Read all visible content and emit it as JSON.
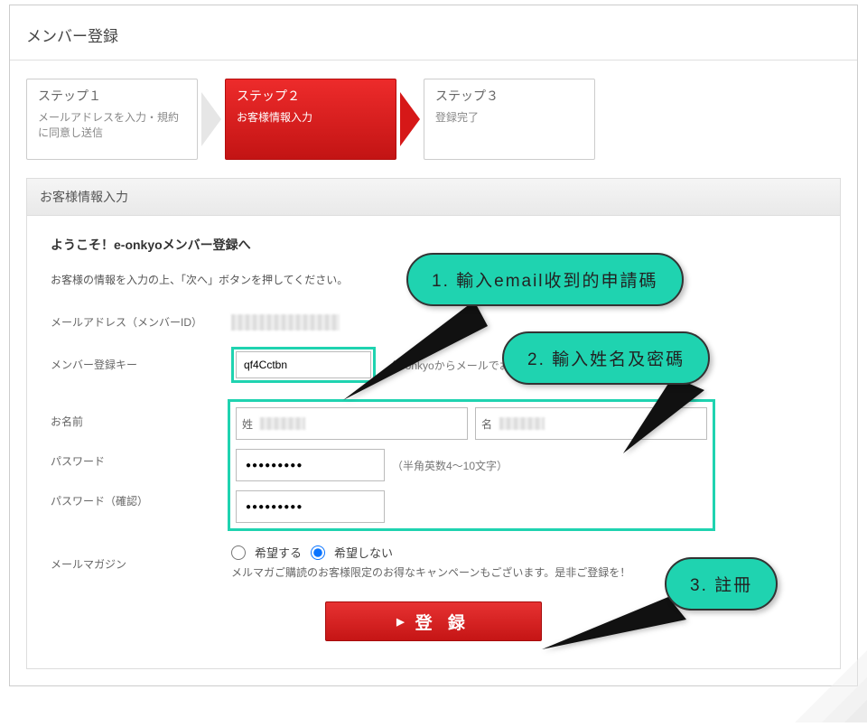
{
  "header": {
    "title": "メンバー登録"
  },
  "steps": [
    {
      "title": "ステップ１",
      "sub": "メールアドレスを入力・規約に同意し送信"
    },
    {
      "title": "ステップ２",
      "sub": "お客様情報入力"
    },
    {
      "title": "ステップ３",
      "sub": "登録完了"
    }
  ],
  "section": {
    "head": "お客様情報入力",
    "welcome": "ようこそ！e-onkyoメンバー登録へ",
    "intro": "お客様の情報を入力の上、「次へ」ボタンを押してください。"
  },
  "form": {
    "email_label": "メールアドレス（メンバーID）",
    "key_label": "メンバー登録キー",
    "key_value": "qf4Cctbn",
    "key_hint": "（e-onkyoからメールでお送りした登録キー）",
    "name_label": "お名前",
    "name_sei": "姓",
    "name_mei": "名",
    "pw_label": "パスワード",
    "pw_hint": "（半角英数4〜10文字）",
    "pw_confirm_label": "パスワード（確認）",
    "mag_label": "メールマガジン",
    "mag_opt_yes": "希望する",
    "mag_opt_no": "希望しない",
    "mag_note": "メルマガご購読のお客様限定のお得なキャンペーンもございます。是非ご登録を！",
    "submit": "登 録"
  },
  "callouts": {
    "c1": "1. 輸入email收到的申請碼",
    "c2": "2. 輸入姓名及密碼",
    "c3": "3. 註冊"
  }
}
